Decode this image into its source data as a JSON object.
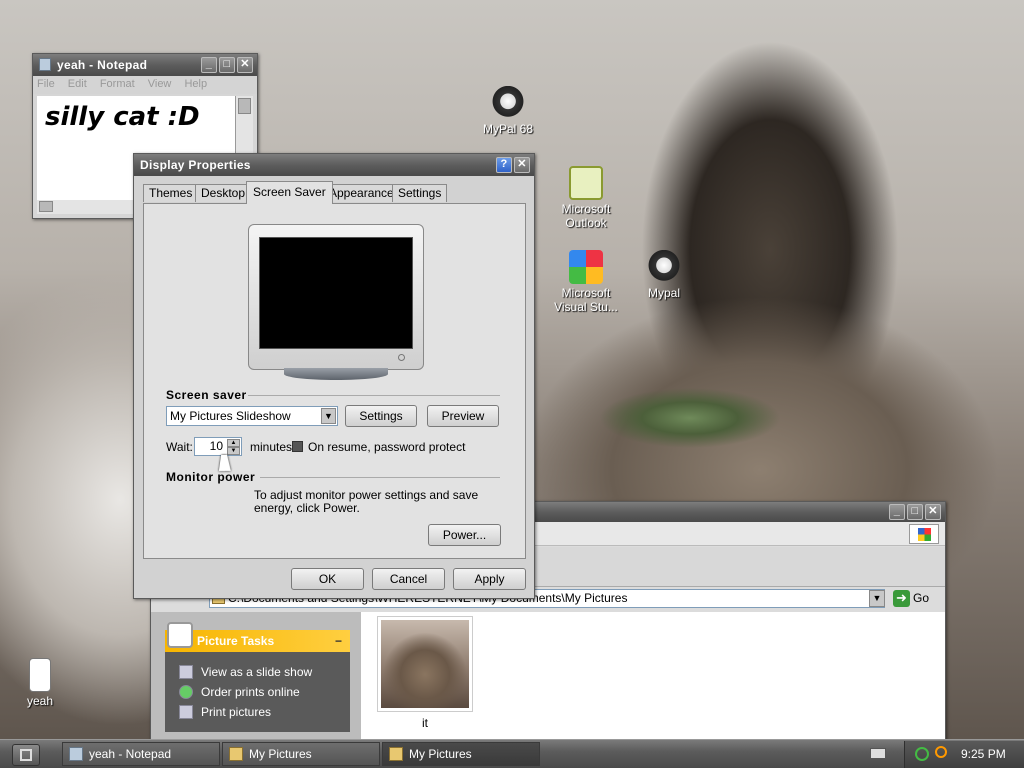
{
  "desktop_icons": [
    {
      "label": "MyPal 68"
    },
    {
      "label": "Microsoft Outlook"
    },
    {
      "label": "Microsoft Visual Stu..."
    },
    {
      "label": "Mypal"
    },
    {
      "label": "yeah"
    }
  ],
  "notepad": {
    "title": "yeah - Notepad",
    "menu": [
      "File",
      "Edit",
      "Format",
      "View",
      "Help"
    ],
    "content": "silly cat :D"
  },
  "explorer": {
    "address_value": "C:\\Documents and Settings\\WHERESTERNET\\My Documents\\My Pictures",
    "go_label": "Go",
    "tasks_title": "Picture Tasks",
    "tasks": [
      "View as a slide show",
      "Order prints online",
      "Print pictures"
    ],
    "file_name": "it"
  },
  "display_properties": {
    "title": "Display Properties",
    "tabs": [
      "Themes",
      "Desktop",
      "Screen Saver",
      "Appearance",
      "Settings"
    ],
    "active_tab": "Screen Saver",
    "screen_saver_label": "Screen saver",
    "screen_saver_value": "My Pictures Slideshow",
    "settings_button": "Settings",
    "preview_button": "Preview",
    "wait_label": "Wait:",
    "wait_value": "10",
    "minutes_label": "minutes",
    "password_label": "On resume, password protect",
    "monitor_power_label": "Monitor power",
    "monitor_power_text": "To adjust monitor power settings and save energy, click Power.",
    "power_button": "Power...",
    "ok_button": "OK",
    "cancel_button": "Cancel",
    "apply_button": "Apply"
  },
  "taskbar": {
    "buttons": [
      "yeah - Notepad",
      "My Pictures",
      "My Pictures"
    ],
    "clock": "9:25 PM"
  }
}
